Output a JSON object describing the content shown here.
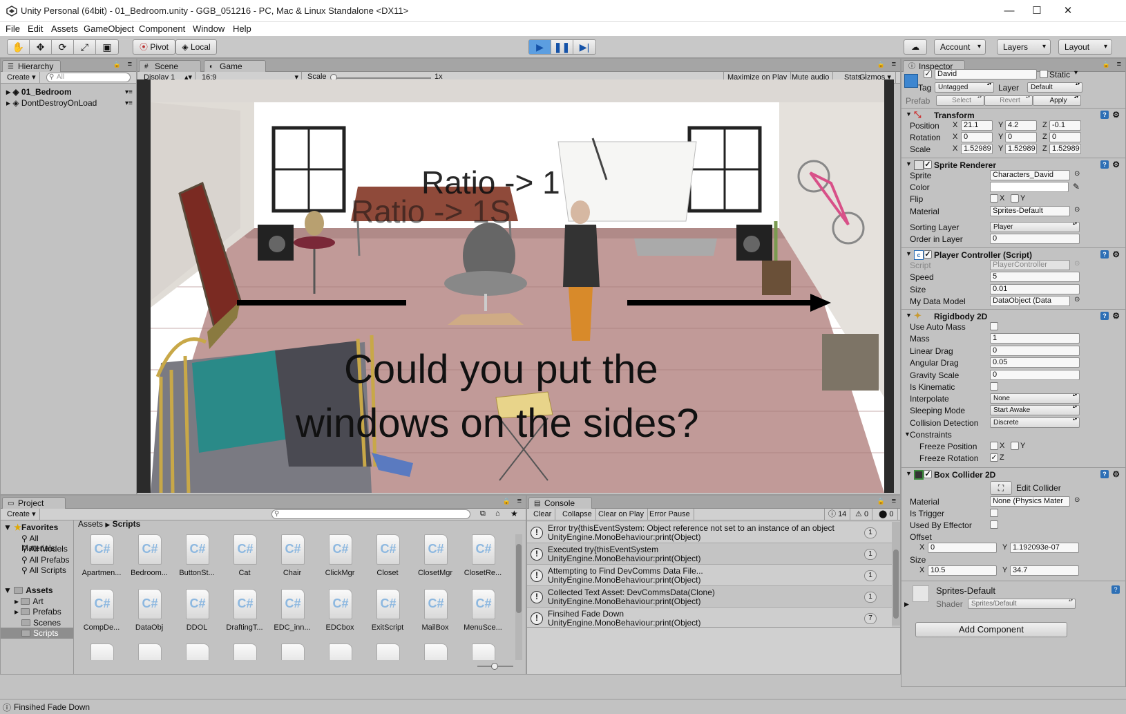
{
  "window": {
    "title": "Unity Personal (64bit) - 01_Bedroom.unity - GGB_051216 - PC, Mac & Linux Standalone <DX11>",
    "minimize": "—",
    "maximize": "☐",
    "close": "✕"
  },
  "menu": [
    "File",
    "Edit",
    "Assets",
    "GameObject",
    "Component",
    "Window",
    "Help"
  ],
  "toolbar": {
    "pivot": "Pivot",
    "local": "Local",
    "account": "Account",
    "layers": "Layers",
    "layout": "Layout"
  },
  "hierarchy": {
    "tab": "Hierarchy",
    "create": "Create",
    "search_placeholder": "All",
    "items": [
      "01_Bedroom",
      "DontDestroyOnLoad"
    ]
  },
  "scene_tab": "Scene",
  "game_tab": "Game",
  "game_bar": {
    "display": "Display 1",
    "aspect": "16:9",
    "scale_label": "Scale",
    "scale_value": "1x",
    "maximize": "Maximize on Play",
    "mute": "Mute audio",
    "stats": "Stats",
    "gizmos": "Gizmos"
  },
  "game_text": {
    "ratio_line1": "Ratio -> 1",
    "ratio_line2": "Ratio -> 1S",
    "question_line1": "Could you put the",
    "question_line2": "windows on the sides?"
  },
  "inspector": {
    "tab": "Inspector",
    "object_name": "David",
    "static": "Static",
    "tag_label": "Tag",
    "tag": "Untagged",
    "layer_label": "Layer",
    "layer": "Default",
    "prefab_label": "Prefab",
    "prefab_select": "Select",
    "prefab_revert": "Revert",
    "prefab_apply": "Apply",
    "transform": {
      "title": "Transform",
      "position_label": "Position",
      "position": [
        "21.1",
        "4.2",
        "-0.1"
      ],
      "rotation_label": "Rotation",
      "rotation": [
        "0",
        "0",
        "0"
      ],
      "scale_label": "Scale",
      "scale": [
        "1.52989",
        "1.52989",
        "1.52989"
      ]
    },
    "sprite_renderer": {
      "title": "Sprite Renderer",
      "sprite_label": "Sprite",
      "sprite": "Characters_David",
      "color_label": "Color",
      "flip_label": "Flip",
      "flip_x": "X",
      "flip_y": "Y",
      "material_label": "Material",
      "material": "Sprites-Default",
      "sorting_layer_label": "Sorting Layer",
      "sorting_layer": "Player",
      "order_label": "Order in Layer",
      "order": "0"
    },
    "player_controller": {
      "title": "Player Controller (Script)",
      "script_label": "Script",
      "script": "PlayerController",
      "speed_label": "Speed",
      "speed": "5",
      "size_label": "Size",
      "size": "0.01",
      "model_label": "My Data Model",
      "model": "DataObject (Data"
    },
    "rigidbody": {
      "title": "Rigidbody 2D",
      "auto_mass_label": "Use Auto Mass",
      "mass_label": "Mass",
      "mass": "1",
      "linear_drag_label": "Linear Drag",
      "linear_drag": "0",
      "angular_drag_label": "Angular Drag",
      "angular_drag": "0.05",
      "gravity_label": "Gravity Scale",
      "gravity": "0",
      "kinematic_label": "Is Kinematic",
      "interpolate_label": "Interpolate",
      "interpolate": "None",
      "sleeping_label": "Sleeping Mode",
      "sleeping": "Start Awake",
      "collision_label": "Collision Detection",
      "collision": "Discrete",
      "constraints_label": "Constraints",
      "freeze_pos_label": "Freeze Position",
      "freeze_rot_label": "Freeze Rotation",
      "x": "X",
      "y": "Y",
      "z": "Z"
    },
    "box_collider": {
      "title": "Box Collider 2D",
      "edit": "Edit Collider",
      "material_label": "Material",
      "material": "None (Physics Mater",
      "trigger_label": "Is Trigger",
      "effector_label": "Used By Effector",
      "offset_label": "Offset",
      "offset": [
        "0",
        "1.192093e-07"
      ],
      "size_label": "Size",
      "size": [
        "10.5",
        "34.7"
      ]
    },
    "material": {
      "name": "Sprites-Default",
      "shader_label": "Shader",
      "shader": "Sprites/Default"
    },
    "add_component": "Add Component"
  },
  "project": {
    "tab": "Project",
    "create": "Create",
    "favorites_label": "Favorites",
    "favorites": [
      "All Materials",
      "All Models",
      "All Prefabs",
      "All Scripts"
    ],
    "assets_label": "Assets",
    "folders": [
      "Art",
      "Prefabs",
      "Scenes",
      "Scripts"
    ],
    "breadcrumb": [
      "Assets",
      "Scripts"
    ],
    "scripts": [
      "Apartmen...",
      "Bedroom...",
      "ButtonSt...",
      "Cat",
      "Chair",
      "ClickMgr",
      "Closet",
      "ClosetMgr",
      "ClosetRe...",
      "CompDe...",
      "DataObj",
      "DDOL",
      "DraftingT...",
      "EDC_inn...",
      "EDCbox",
      "ExitScript",
      "MailBox",
      "MenuSce..."
    ]
  },
  "console": {
    "tab": "Console",
    "clear": "Clear",
    "collapse": "Collapse",
    "clear_on_play": "Clear on Play",
    "error_pause": "Error Pause",
    "counts": [
      "14",
      "0",
      "0"
    ],
    "logs": [
      {
        "line1": "Error try{thisEventSystem: Object reference not set to an instance of an object",
        "line2": "UnityEngine.MonoBehaviour:print(Object)",
        "count": "1"
      },
      {
        "line1": "Executed try{thisEventSystem",
        "line2": "UnityEngine.MonoBehaviour:print(Object)",
        "count": "1"
      },
      {
        "line1": "Attempting to Find DevComms Data File...",
        "line2": "UnityEngine.MonoBehaviour:print(Object)",
        "count": "1"
      },
      {
        "line1": "Collected Text Asset: DevCommsData(Clone)",
        "line2": "UnityEngine.MonoBehaviour:print(Object)",
        "count": "1"
      },
      {
        "line1": "Finsihed Fade Down",
        "line2": "UnityEngine.MonoBehaviour:print(Object)",
        "count": "7"
      }
    ]
  },
  "status": "Finsihed Fade Down",
  "colors": {
    "accent": "#3c8ddc",
    "selection": "#3e7fd6",
    "floor": "#b89a96"
  }
}
